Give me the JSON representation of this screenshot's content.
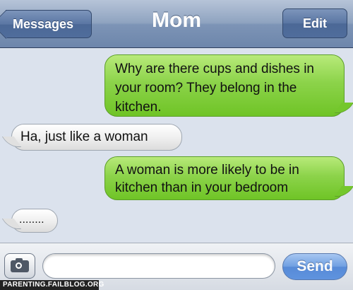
{
  "header": {
    "title": "Mom",
    "back_label": "Messages",
    "edit_label": "Edit"
  },
  "messages": [
    {
      "direction": "outgoing",
      "text": "Why are there cups and dishes in your room? They belong in the kitchen."
    },
    {
      "direction": "incoming",
      "text": "Ha, just like a woman"
    },
    {
      "direction": "outgoing",
      "text": "A woman is more likely to be in kitchen than in your bedroom"
    },
    {
      "direction": "incoming",
      "text": "........"
    }
  ],
  "composer": {
    "camera_icon": "camera-icon",
    "input_value": "",
    "send_label": "Send"
  },
  "watermark": "PARENTING.FAILBLOG.ORG",
  "colors": {
    "outgoing_bubble": "#8cd34a",
    "incoming_bubble": "#f0f0f0",
    "navbar": "#7d94b6",
    "send_button": "#4a86de"
  }
}
